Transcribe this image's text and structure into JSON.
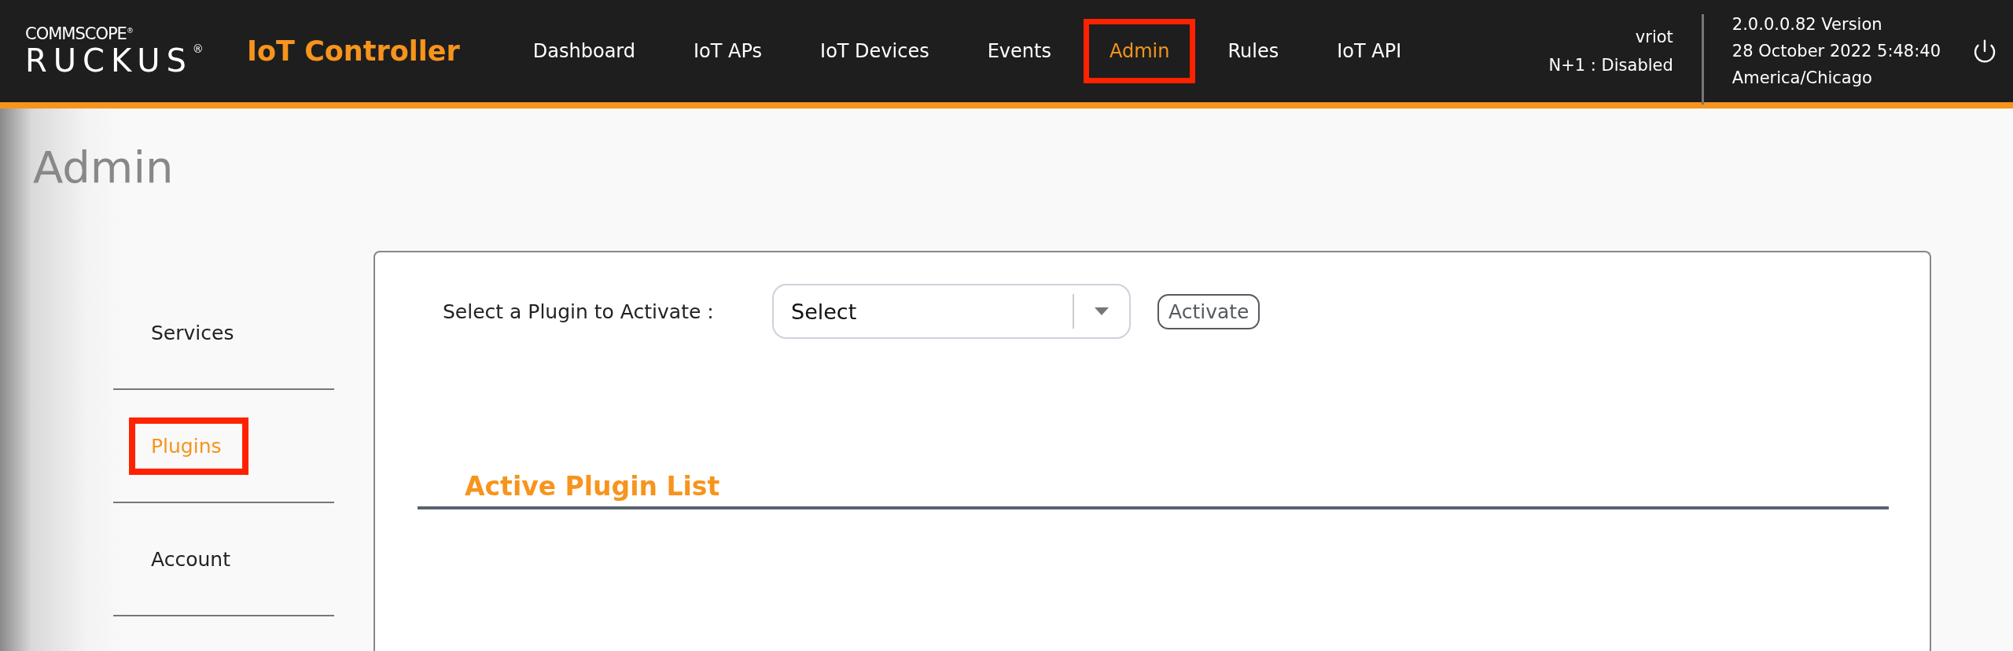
{
  "header": {
    "logo": {
      "top": "COMMSCOPE$^{®}$",
      "bottom": "RUCKUS$^{®}$"
    },
    "product": "IoT Controller",
    "nav": [
      {
        "label": "Dashboard",
        "selected": false,
        "highlighted": false
      },
      {
        "label": "IoT APs",
        "selected": false,
        "highlighted": false
      },
      {
        "label": "IoT Devices",
        "selected": false,
        "highlighted": false
      },
      {
        "label": "Events",
        "selected": false,
        "highlighted": false
      },
      {
        "label": "Admin",
        "selected": true,
        "highlighted": true
      },
      {
        "label": "Rules",
        "selected": false,
        "highlighted": false
      },
      {
        "label": "IoT API",
        "selected": false,
        "highlighted": false
      }
    ],
    "user": "vriot",
    "ha_status": "N+1 : Disabled",
    "version": "2.0.0.0.82 Version",
    "datetime": "28 October 2022 5:48:40",
    "timezone": "America/Chicago"
  },
  "page_title": "Admin",
  "sidebar": {
    "items": [
      {
        "label": "Services",
        "selected": false,
        "highlighted": false
      },
      {
        "label": "Plugins",
        "selected": true,
        "highlighted": true
      },
      {
        "label": "Account",
        "selected": false,
        "highlighted": false
      }
    ]
  },
  "panel": {
    "select_label": "Select a Plugin to Activate :",
    "select": {
      "value": "Select"
    },
    "activate_button": "Activate",
    "section_title": "Active Plugin List"
  }
}
